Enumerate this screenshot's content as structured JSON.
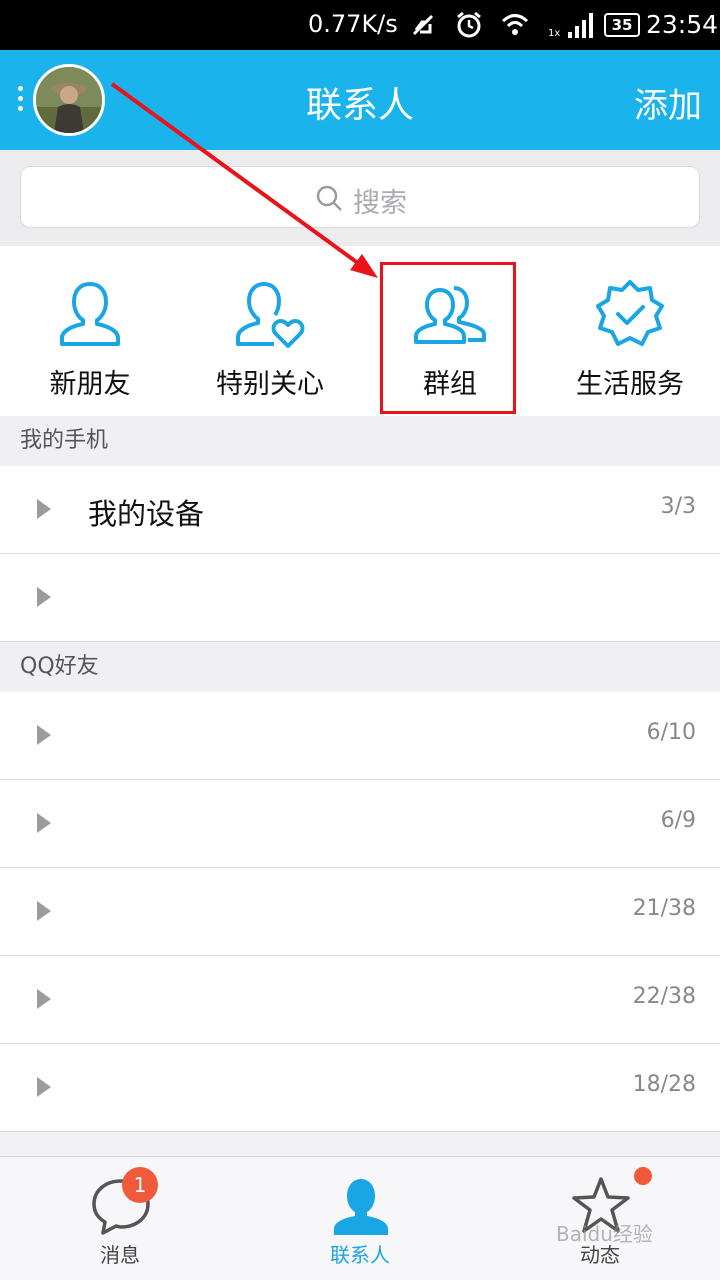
{
  "status_bar": {
    "speed": "0.77K/s",
    "battery": "35",
    "time": "23:54"
  },
  "header": {
    "title": "联系人",
    "add_label": "添加"
  },
  "search": {
    "placeholder": "搜索"
  },
  "quick_actions": [
    {
      "label": "新朋友",
      "icon": "person-icon"
    },
    {
      "label": "特别关心",
      "icon": "person-heart-icon"
    },
    {
      "label": "群组",
      "icon": "group-icon"
    },
    {
      "label": "生活服务",
      "icon": "verified-badge-icon"
    }
  ],
  "sections": {
    "my_phone": "我的手机",
    "qq_friends": "QQ好友"
  },
  "my_phone_groups": [
    {
      "name": "我的设备",
      "count": "3/3"
    },
    {
      "name": "",
      "count": ""
    }
  ],
  "friend_groups": [
    {
      "name": "",
      "count": "6/10"
    },
    {
      "name": "",
      "count": "6/9"
    },
    {
      "name": "",
      "count": "21/38"
    },
    {
      "name": "",
      "count": "22/38"
    },
    {
      "name": "",
      "count": "18/28"
    }
  ],
  "tabs": [
    {
      "label": "消息",
      "badge": "1"
    },
    {
      "label": "联系人"
    },
    {
      "label": "动态"
    }
  ],
  "watermark": "Baidu经验",
  "colors": {
    "accent": "#1ab3ec",
    "highlight": "#e8131b",
    "badge": "#f05a3a"
  }
}
